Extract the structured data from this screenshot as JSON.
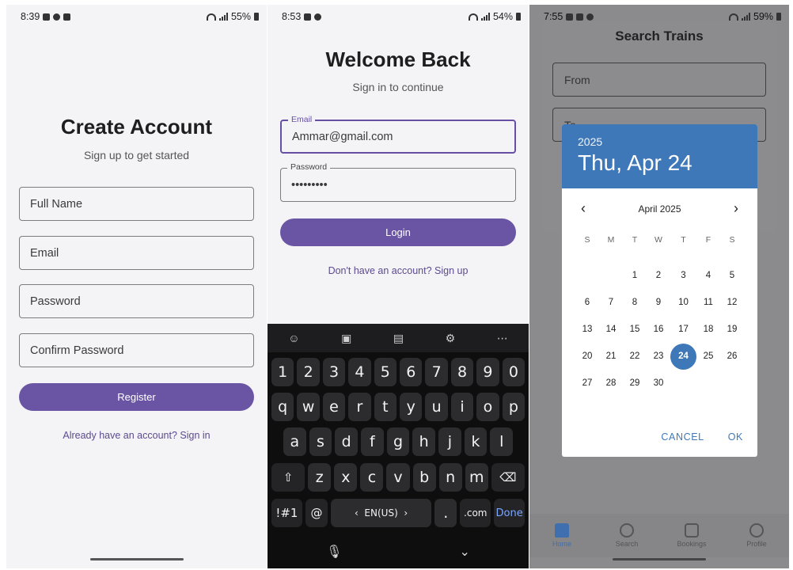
{
  "screen1": {
    "status": {
      "time": "8:39",
      "battery": "55%"
    },
    "title": "Create Account",
    "subtitle": "Sign up to get started",
    "fields": [
      {
        "placeholder": "Full Name"
      },
      {
        "placeholder": "Email"
      },
      {
        "placeholder": "Password"
      },
      {
        "placeholder": "Confirm Password"
      }
    ],
    "button": "Register",
    "link": "Already have an account? Sign in"
  },
  "screen2": {
    "status": {
      "time": "8:53",
      "battery": "54%"
    },
    "title": "Welcome Back",
    "subtitle": "Sign in to continue",
    "email": {
      "label": "Email",
      "value": "Ammar@gmail.com"
    },
    "password": {
      "label": "Password",
      "value": "•••••••••"
    },
    "button": "Login",
    "link": "Don't have an account? Sign up",
    "keyboard": {
      "row_numbers": [
        "1",
        "2",
        "3",
        "4",
        "5",
        "6",
        "7",
        "8",
        "9",
        "0"
      ],
      "row1": [
        "q",
        "w",
        "e",
        "r",
        "t",
        "y",
        "u",
        "i",
        "o",
        "p"
      ],
      "row2": [
        "a",
        "s",
        "d",
        "f",
        "g",
        "h",
        "j",
        "k",
        "l"
      ],
      "row3": [
        "z",
        "x",
        "c",
        "v",
        "b",
        "n",
        "m"
      ],
      "symbols_key": "!#1",
      "at_key": "@",
      "language": "EN(US)",
      "period_key": ".",
      "com_key": ".com",
      "done_key": "Done"
    }
  },
  "screen3": {
    "status": {
      "time": "7:55",
      "battery": "59%"
    },
    "title": "Search Trains",
    "from_placeholder": "From",
    "to_placeholder": "To",
    "datepicker": {
      "year": "2025",
      "selected_label": "Thu, Apr 24",
      "month_label": "April 2025",
      "weekdays": [
        "S",
        "M",
        "T",
        "W",
        "T",
        "F",
        "S"
      ],
      "leading_blanks": 2,
      "days_in_month": 30,
      "selected_day": 24,
      "cancel": "CANCEL",
      "ok": "OK",
      "accent_color": "#3f78b8"
    },
    "tabs": [
      {
        "label": "Home",
        "icon": "home-icon"
      },
      {
        "label": "Search",
        "icon": "search-icon"
      },
      {
        "label": "Bookings",
        "icon": "calendar-icon"
      },
      {
        "label": "Profile",
        "icon": "profile-icon"
      }
    ]
  }
}
